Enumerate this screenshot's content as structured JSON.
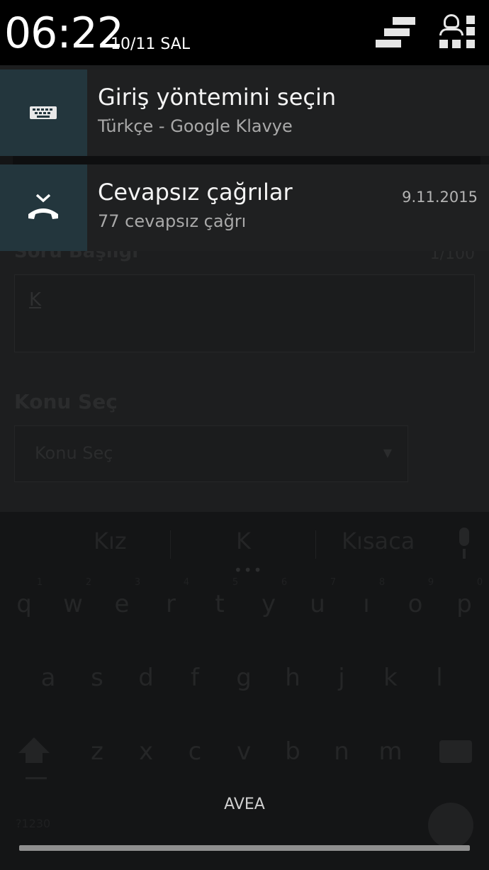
{
  "status_bar": {
    "time": "06:22",
    "date": "10/11 SAL",
    "icons": [
      "clear-all-notifications-icon",
      "quick-settings-icon"
    ]
  },
  "notifications": [
    {
      "icon": "keyboard-icon",
      "title": "Giriş yöntemini seçin",
      "subtitle": "Türkçe - Google Klavye",
      "time": ""
    },
    {
      "icon": "missed-call-icon",
      "title": "Cevapsız çağrılar",
      "subtitle": "77 cevapsız çağrı",
      "time": "9.11.2015"
    }
  ],
  "background_app": {
    "question_title_label": "Soru Başlığı",
    "char_count": "1/100",
    "question_input_value": "K",
    "topic_label": "Konu Seç",
    "topic_select_value": "Konu Seç"
  },
  "keyboard": {
    "suggestions": [
      "Kız",
      "K",
      "Kısaca"
    ],
    "row1_numbers": [
      "1",
      "2",
      "3",
      "4",
      "5",
      "6",
      "7",
      "8",
      "9",
      "0"
    ],
    "row1": [
      "q",
      "w",
      "e",
      "r",
      "t",
      "y",
      "u",
      "ı",
      "o",
      "p"
    ],
    "row2": [
      "a",
      "s",
      "d",
      "f",
      "g",
      "h",
      "j",
      "k",
      "l"
    ],
    "row3": [
      "z",
      "x",
      "c",
      "v",
      "b",
      "n",
      "m"
    ],
    "small_text": "?1230"
  },
  "carrier": "AVEA",
  "colors": {
    "notification_icon_bg": "#23363d",
    "notification_bg": "#1f2021",
    "status_bar_bg": "#000000"
  }
}
